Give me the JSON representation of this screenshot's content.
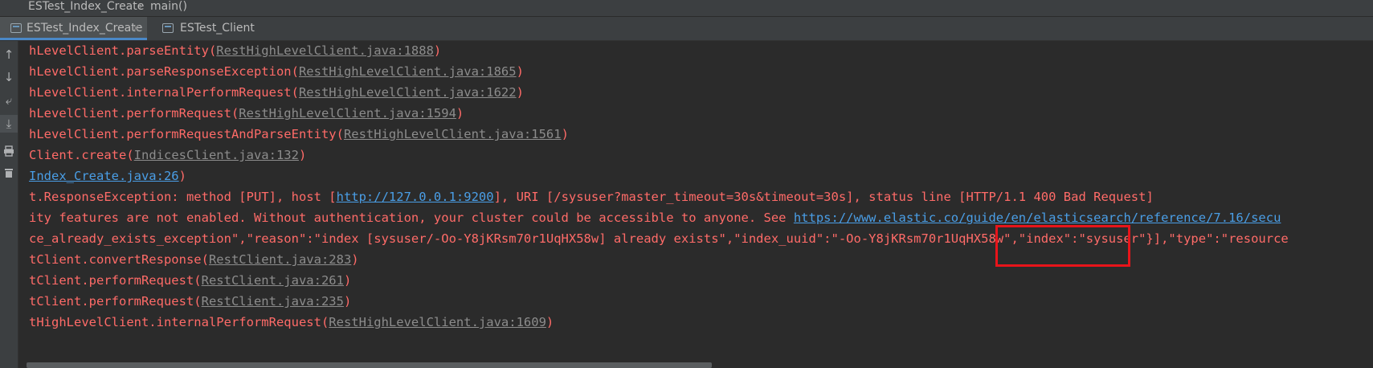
{
  "breadcrumb": {
    "class_name": "ESTest_Index_Create",
    "separator": "›",
    "method": "main()"
  },
  "tabs": [
    {
      "label": "ESTest_Index_Create",
      "close": "×",
      "active": true
    },
    {
      "label": "ESTest_Client",
      "close": "",
      "active": false
    }
  ],
  "toolbar": {
    "icons": [
      "up-arrow-icon",
      "down-arrow-icon",
      "soft-wrap-icon",
      "scroll-to-end-icon",
      "print-icon",
      "trash-icon"
    ]
  },
  "console": {
    "lines": [
      {
        "prefix": "hLevelClient.parseEntity(",
        "link": "RestHighLevelClient.java:1888",
        "suffix": ")"
      },
      {
        "prefix": "hLevelClient.parseResponseException(",
        "link": "RestHighLevelClient.java:1865",
        "suffix": ")"
      },
      {
        "prefix": "hLevelClient.internalPerformRequest(",
        "link": "RestHighLevelClient.java:1622",
        "suffix": ")"
      },
      {
        "prefix": "hLevelClient.performRequest(",
        "link": "RestHighLevelClient.java:1594",
        "suffix": ")"
      },
      {
        "prefix": "hLevelClient.performRequestAndParseEntity(",
        "link": "RestHighLevelClient.java:1561",
        "suffix": ")"
      },
      {
        "prefix": "Client.create(",
        "link": "IndicesClient.java:132",
        "suffix": ")"
      },
      {
        "prefix": "",
        "link": "Index_Create.java:26",
        "suffix": ")"
      },
      {
        "prefix": "t.ResponseException: method [PUT], host [",
        "link": "http://127.0.0.1:9200",
        "suffix": "], URI [/sysuser?master_timeout=30s&timeout=30s], status line [HTTP/1.1 400 Bad Request]"
      },
      {
        "prefix": "ity features are not enabled. Without authentication, your cluster could be accessible to anyone. See ",
        "link": "https://www.elastic.co/guide/en/elasticsearch/reference/7.16/secu",
        "suffix": ""
      },
      {
        "prefix": "ce_already_exists_exception\",\"reason\":\"index [sysuser/-Oo-Y8jKRsm70r1UqHX58w] already exists\",\"index_uuid\":\"-Oo-Y8jKRsm70r1UqHX58w\",\"index\":\"sysuser\"}],\"type\":\"resource",
        "link": "",
        "suffix": ""
      },
      {
        "prefix": "tClient.convertResponse(",
        "link": "RestClient.java:283",
        "suffix": ")"
      },
      {
        "prefix": "tClient.performRequest(",
        "link": "RestClient.java:261",
        "suffix": ")"
      },
      {
        "prefix": "tClient.performRequest(",
        "link": "RestClient.java:235",
        "suffix": ")"
      },
      {
        "prefix": "tHighLevelClient.internalPerformRequest(",
        "link": "RestHighLevelClient.java:1609",
        "suffix": ")"
      }
    ]
  },
  "colors": {
    "error_text": "#ff6b68",
    "trace_link": "#8c8c8c",
    "url_link": "#4a9ee6",
    "highlight_box": "#e8141a",
    "background": "#2b2b2b"
  }
}
